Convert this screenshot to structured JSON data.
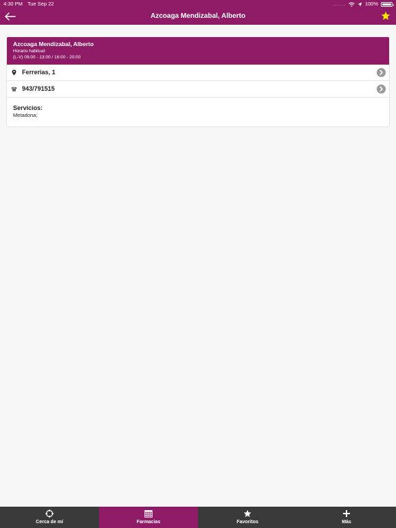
{
  "status_bar": {
    "time": "4:30 PM",
    "date": "Tue Sep 22",
    "battery": "100%",
    "signal": "......"
  },
  "nav": {
    "title": "Azcoaga Mendizabal, Alberto",
    "back_icon": "arrow-left-icon",
    "favorite_icon": "star-icon",
    "favorite_color": "#ffe600"
  },
  "pharmacy": {
    "name": "Azcoaga Mendizabal, Alberto",
    "hours_label": "Horario habitual:",
    "hours": "(L-V) 09:00 - 13:00 / 16:00 - 20:00",
    "address": "Ferrerias, 1",
    "address_icon": "location-pin-icon",
    "phone": "943/791515",
    "phone_icon": "phone-icon",
    "services_label": "Servicios:",
    "services": "Metadona;"
  },
  "tabs": [
    {
      "label": "Cerca de mí",
      "icon": "crosshair-icon",
      "active": false
    },
    {
      "label": "Farmacias",
      "icon": "calendar-icon",
      "active": true
    },
    {
      "label": "Favoritos",
      "icon": "star-icon",
      "active": false
    },
    {
      "label": "Más",
      "icon": "plus-icon",
      "active": false
    }
  ],
  "colors": {
    "brand": "#8f1b66",
    "tabbar": "#3a3a3a",
    "chevron": "#9a9a9a"
  }
}
